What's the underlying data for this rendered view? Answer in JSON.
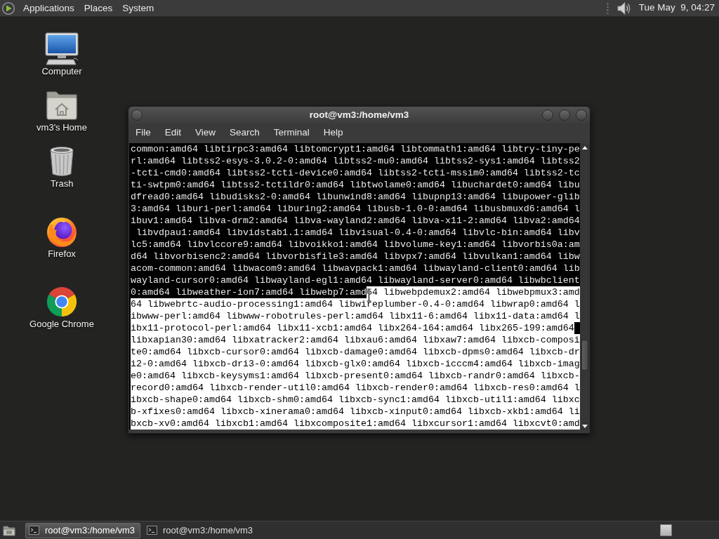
{
  "top_panel": {
    "menus": [
      "Applications",
      "Places",
      "System"
    ],
    "clock": "Tue May  9, 04:27"
  },
  "desktop_icons": [
    {
      "kind": "computer",
      "label": "Computer"
    },
    {
      "kind": "home",
      "label": "vm3's Home"
    },
    {
      "kind": "trash",
      "label": "Trash"
    },
    {
      "kind": "firefox",
      "label": "Firefox"
    },
    {
      "kind": "chrome",
      "label": "Google Chrome"
    }
  ],
  "terminal_window": {
    "title": "root@vm3:/home/vm3",
    "menu": [
      "File",
      "Edit",
      "View",
      "Search",
      "Terminal",
      "Help"
    ],
    "lines": [
      [
        {
          "text": "common:amd64 libtirpc3:amd64 libtomcrypt1:amd64 libtommath1:amd64 libtry-tiny-pe",
          "selected": false
        }
      ],
      [
        {
          "text": "rl:amd64 libtss2-esys-3.0.2-0:amd64 libtss2-mu0:amd64 libtss2-sys1:amd64 libtss2",
          "selected": false
        }
      ],
      [
        {
          "text": "-tcti-cmd0:amd64 libtss2-tcti-device0:amd64 libtss2-tcti-mssim0:amd64 libtss2-tc",
          "selected": false
        }
      ],
      [
        {
          "text": "ti-swtpm0:amd64 libtss2-tctildr0:amd64 libtwolame0:amd64 libuchardet0:amd64 libu",
          "selected": false
        }
      ],
      [
        {
          "text": "dfread0:amd64 libudisks2-0:amd64 libunwind8:amd64 libupnp13:amd64 libupower-glib",
          "selected": false
        }
      ],
      [
        {
          "text": "3:amd64 liburi-perl:amd64 liburing2:amd64 libusb-1.0-0:amd64 libusbmuxd6:amd64 l",
          "selected": false
        }
      ],
      [
        {
          "text": "ibuv1:amd64 libva-drm2:amd64 libva-wayland2:amd64 libva-x11-2:amd64 libva2:amd64",
          "selected": false
        }
      ],
      [
        {
          "text": " libvdpau1:amd64 libvidstab1.1:amd64 libvisual-0.4-0:amd64 libvlc-bin:amd64 libv",
          "selected": false
        }
      ],
      [
        {
          "text": "lc5:amd64 libvlccore9:amd64 libvoikko1:amd64 libvolume-key1:amd64 libvorbis0a:am",
          "selected": false
        }
      ],
      [
        {
          "text": "d64 libvorbisenc2:amd64 libvorbisfile3:amd64 libvpx7:amd64 libvulkan1:amd64 libw",
          "selected": false
        }
      ],
      [
        {
          "text": "acom-common:amd64 libwacom9:amd64 libwavpack1:amd64 libwayland-client0:amd64 lib",
          "selected": false
        }
      ],
      [
        {
          "text": "wayland-cursor0:amd64 libwayland-egl1:amd64 libwayland-server0:amd64 libwbclient",
          "selected": false
        }
      ],
      [
        {
          "text": "0:amd64 libweather-ion7:amd64 libwebp7:amd",
          "selected": false
        },
        {
          "text": "64 libwebpdemux2:amd64 libwebpmux3:amd",
          "selected": true
        }
      ],
      [
        {
          "text": "64 libwebrtc-audio-processing1:amd64 libwireplumber-0.4-0:amd64 libwrap0:amd64 l",
          "selected": true
        }
      ],
      [
        {
          "text": "ibwww-perl:amd64 libwww-robotrules-perl:amd64 libx11-6:amd64 libx11-data:amd64 l",
          "selected": true
        }
      ],
      [
        {
          "text": "ibx11-protocol-perl:amd64 libx11-xcb1:amd64 libx264-164:amd64 libx265-199:amd64",
          "selected": true
        }
      ],
      [
        {
          "text": "libxapian30:amd64 libxatracker2:amd64 libxau6:amd64 libxaw7:amd64 libxcb-composi",
          "selected": true
        }
      ],
      [
        {
          "text": "te0:amd64 libxcb-cursor0:amd64 libxcb-damage0:amd64 libxcb-dpms0:amd64 libxcb-dr",
          "selected": true
        }
      ],
      [
        {
          "text": "i2-0:amd64 libxcb-dri3-0:amd64 libxcb-glx0:amd64 libxcb-icccm4:amd64 libxcb-imag",
          "selected": true
        }
      ],
      [
        {
          "text": "e0:amd64 libxcb-keysyms1:amd64 libxcb-present0:amd64 libxcb-randr0:amd64 libxcb-",
          "selected": true
        }
      ],
      [
        {
          "text": "record0:amd64 libxcb-render-util0:amd64 libxcb-render0:amd64 libxcb-res0:amd64 l",
          "selected": true
        }
      ],
      [
        {
          "text": "ibxcb-shape0:amd64 libxcb-shm0:amd64 libxcb-sync1:amd64 libxcb-util1:amd64 libxc",
          "selected": true
        }
      ],
      [
        {
          "text": "b-xfixes0:amd64 libxcb-xinerama0:amd64 libxcb-xinput0:amd64 libxcb-xkb1:amd64 li",
          "selected": true
        }
      ],
      [
        {
          "text": "bxcb-xv0:amd64 libxcb1:amd64 libxcomposite1:amd64 libxcursor1:amd64 libxcvt0:amd",
          "selected": true
        }
      ]
    ]
  },
  "taskbar": {
    "tasks": [
      {
        "label": "root@vm3:/home/vm3",
        "selected": true
      },
      {
        "label": "root@vm3:/home/vm3",
        "selected": false
      }
    ]
  }
}
